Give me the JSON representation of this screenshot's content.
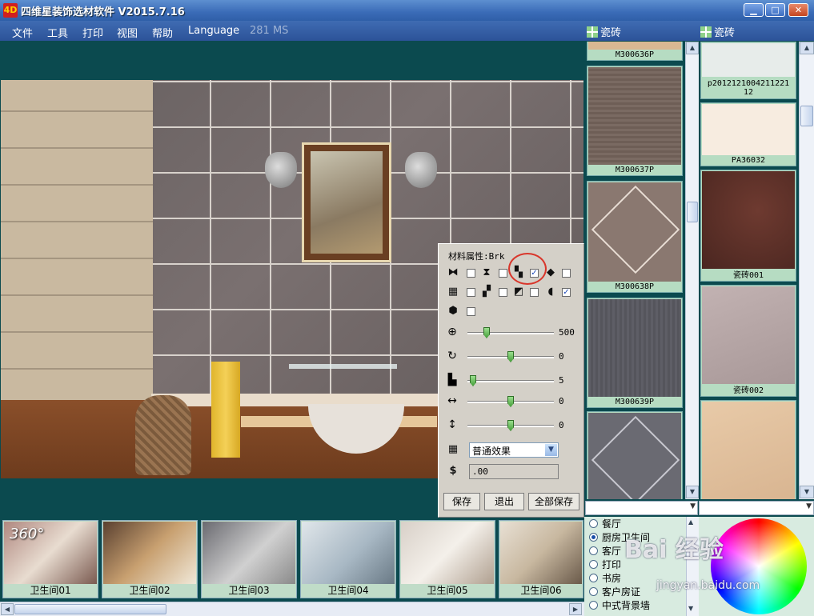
{
  "window": {
    "title": "四维星装饰选材软件 V2015.7.16",
    "icon_text": "4D",
    "minimize": "▁",
    "maximize": "□",
    "close": "✕"
  },
  "menu": {
    "items": [
      "文件",
      "工具",
      "打印",
      "视图",
      "帮助",
      "Language"
    ],
    "status": "281 MS",
    "tile_tab_left": "瓷砖",
    "tile_tab_right": "瓷砖"
  },
  "material_panel": {
    "title": "材料属性:Brk",
    "checks": [
      {
        "icon": "⧓",
        "checked": false
      },
      {
        "icon": "⧗",
        "checked": false
      },
      {
        "icon": "▚",
        "checked": true
      },
      {
        "icon": "◆",
        "checked": false
      },
      {
        "icon": "▦",
        "checked": false
      },
      {
        "icon": "▞",
        "checked": false
      },
      {
        "icon": "◩",
        "checked": false
      },
      {
        "icon": "◖",
        "checked": true
      },
      {
        "icon": "⬢",
        "checked": false
      }
    ],
    "sliders": [
      {
        "icon": "⊕",
        "value": "500",
        "fraction": 0.15
      },
      {
        "icon": "↻",
        "value": "0",
        "fraction": 0.5
      },
      {
        "icon": "▙",
        "value": "5",
        "fraction": 0.05
      },
      {
        "icon": "↔",
        "value": "0",
        "fraction": 0.5
      },
      {
        "icon": "↕",
        "value": "0",
        "fraction": 0.5
      }
    ],
    "effect_select": "普通效果",
    "price": ".00",
    "buttons": {
      "save": "保存",
      "exit": "退出",
      "save_all": "全部保存"
    }
  },
  "rooms": [
    {
      "label": "卫生间01",
      "badge": "360°"
    },
    {
      "label": "卫生间02"
    },
    {
      "label": "卫生间03"
    },
    {
      "label": "卫生间04"
    },
    {
      "label": "卫生间05"
    },
    {
      "label": "卫生间06"
    }
  ],
  "tiles_left": [
    {
      "name": "M300636P",
      "color": "#d9b892"
    },
    {
      "name": "M300637P",
      "color": "#7a6a62"
    },
    {
      "name": "M300638P",
      "color": "#8a7870"
    },
    {
      "name": "M300639P",
      "color": "#5e5e66"
    },
    {
      "name": "",
      "color": "#6a6a72"
    }
  ],
  "tiles_right": [
    {
      "name": "p2012121004211221 12",
      "color": "#e7ecea"
    },
    {
      "name": "PA36032",
      "color": "#f7ece0"
    },
    {
      "name": "瓷砖001",
      "color": "#5a3028"
    },
    {
      "name": "瓷砖002",
      "color": "#b8a8a8"
    },
    {
      "name": "",
      "color": "#e4c4a4"
    }
  ],
  "room_categories": [
    {
      "label": "餐厅",
      "selected": false
    },
    {
      "label": "厨房卫生间",
      "selected": true
    },
    {
      "label": "客厅",
      "selected": false
    },
    {
      "label": "打印",
      "selected": false
    },
    {
      "label": "书房",
      "selected": false
    },
    {
      "label": "客户房证",
      "selected": false
    },
    {
      "label": "中式背景墙",
      "selected": false
    }
  ],
  "watermark": {
    "brand": "Bai 经验",
    "url": "jingyan.baidu.com"
  },
  "colors": {
    "accent": "#0b4a4f",
    "titlebar": "#3a6bb7",
    "panel": "#d4d0c8",
    "label_bg": "#c0dcc8"
  }
}
